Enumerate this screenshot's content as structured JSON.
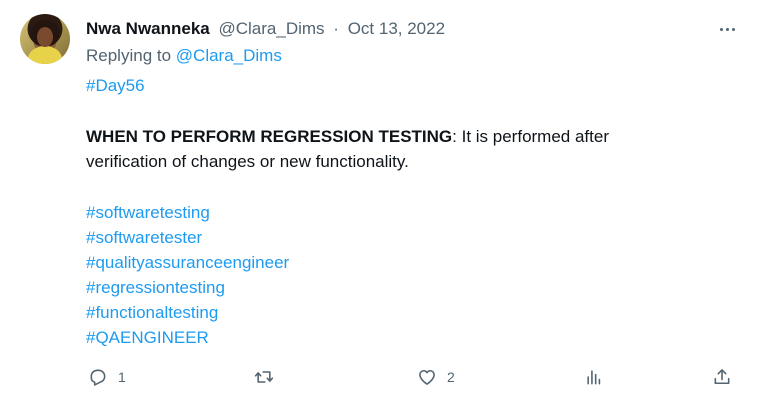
{
  "tweet": {
    "author_name": "Nwa Nwanneka",
    "author_handle": "@Clara_Dims",
    "separator": "·",
    "date": "Oct 13, 2022",
    "replying_to_prefix": "Replying to ",
    "replying_to_handle": "@Clara_Dims",
    "day_tag": "#Day56",
    "body_bold": "WHEN TO PERFORM REGRESSION TESTING",
    "body_line1_rest": ": It is performed after",
    "body_line2": "verification of changes or new functionality.",
    "hashtags": [
      "#softwaretesting",
      "#softwaretester",
      "#qualityassuranceengineer",
      "#regressiontesting",
      "#functionaltesting",
      "#QAENGINEER"
    ]
  },
  "actions": {
    "reply_count": "1",
    "retweet_count": "",
    "like_count": "2"
  },
  "icons": {
    "reply": "reply-icon",
    "retweet": "retweet-icon",
    "like": "heart-icon",
    "analytics": "analytics-icon",
    "share": "share-icon",
    "more": "more-icon"
  },
  "colors": {
    "link": "#1d9bf0",
    "muted": "#536471",
    "text": "#0f1419"
  }
}
